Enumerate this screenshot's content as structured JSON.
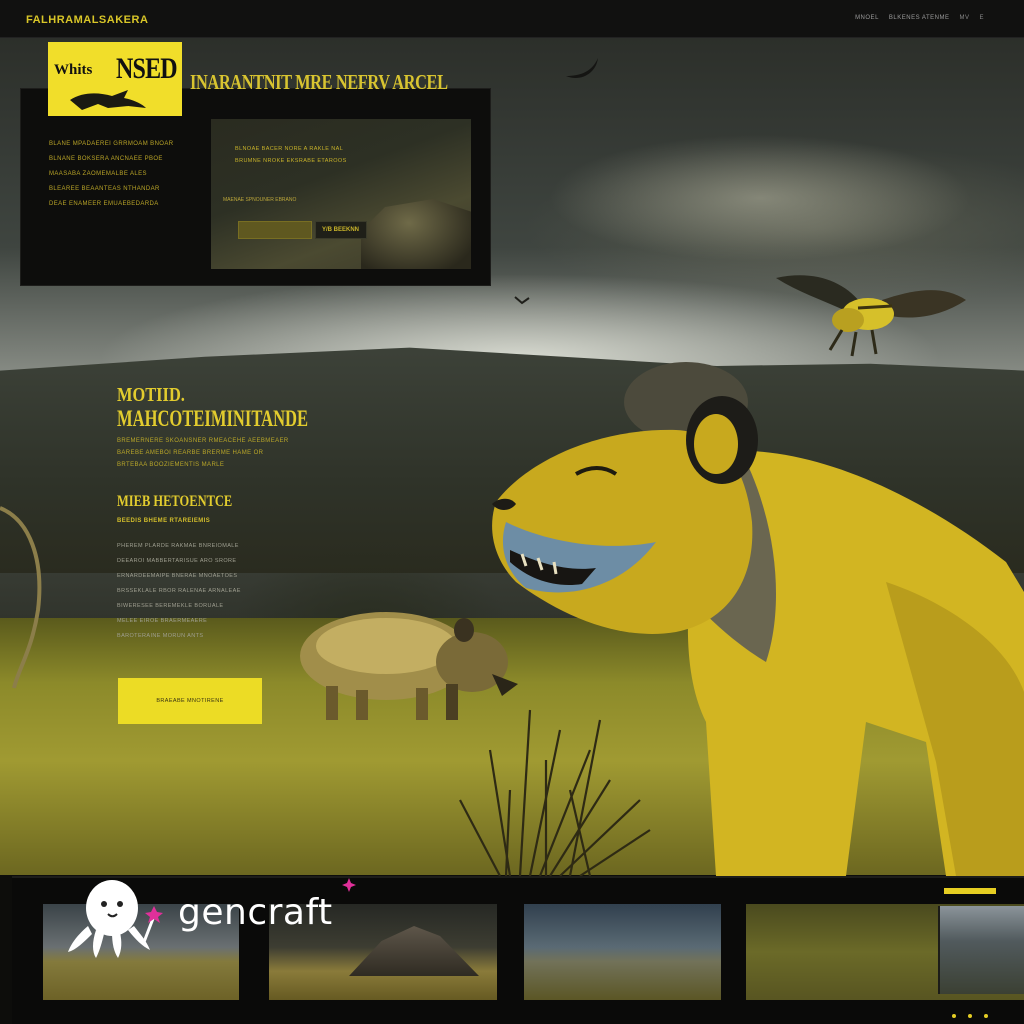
{
  "topbar": {
    "brand": "FALHRAMALSAKERA",
    "nav": [
      "MNOEL",
      "BLKENES ATENME",
      "MV",
      "E"
    ]
  },
  "hero": {
    "logo_small": "Whits",
    "logo_large": "NSED",
    "heading": "INARANTNIT MRE NEFRV ARCEL",
    "text_lines": [
      "BLANE MPADAEREI GRRMOAM BNOAR",
      "BLNANE BOKSERA ANCNAEE PBOE",
      "MAASABA ZAOMEMALBE ALES",
      "BLEAREE BEAANTEAS NTHANDAR",
      "DEAE ENAMEER EMUAEBEDARDA"
    ],
    "inner_lines": [
      "BLNOAE BACER NORE A RAKLE NAL",
      "BRUMNE NROKE EKSRABE ETAROOS"
    ],
    "inner_caption": "MAENAE SPNOUNER EBRANO",
    "inner_secondary_label": "Y/B BEEKNN"
  },
  "section": {
    "kicker": "MOTIID.",
    "title": "MAHCOTEIMINITANDE",
    "body_lines": [
      "BREMERNERE SKOANSNER RMEACEHE AEEBMEAER",
      "BAREBE AMEBOI REARBE BRERME HAME OR",
      "BRTEBAA BOOZIEMENTIS MARLE"
    ],
    "subtitle": "MIEB HETOENTCE",
    "subtitle_small": "BEEDIS BHEME RTAREIEMIS",
    "list_lines": [
      "PHEREM PLARDE RAKMAE BNREIOMALE",
      "DEEAROI MABBERTARISUE ARO SRORE",
      "ERNARDEEMAIPE BNERAE MNOAETOES",
      "BRSSEKLALE RBOR RALENAE ARNALEAE",
      "BIWERESEE BEREMEKLE BORUALE",
      "MELEE EIROE BRAERMEAERE",
      "BAROTERAINE MORUN ANTS"
    ],
    "cta_label": "BRAEABE MNOTIRENE"
  },
  "gallery": {
    "thumbnails": [
      "savanna-mountain",
      "mountain-rock",
      "stormy-plains",
      "grassland"
    ]
  },
  "watermark": {
    "text": "gencraft"
  },
  "colors": {
    "accent": "#ecdc25",
    "text_yellow": "#e2cc2e",
    "dark_panel": "#0d0d0c"
  }
}
